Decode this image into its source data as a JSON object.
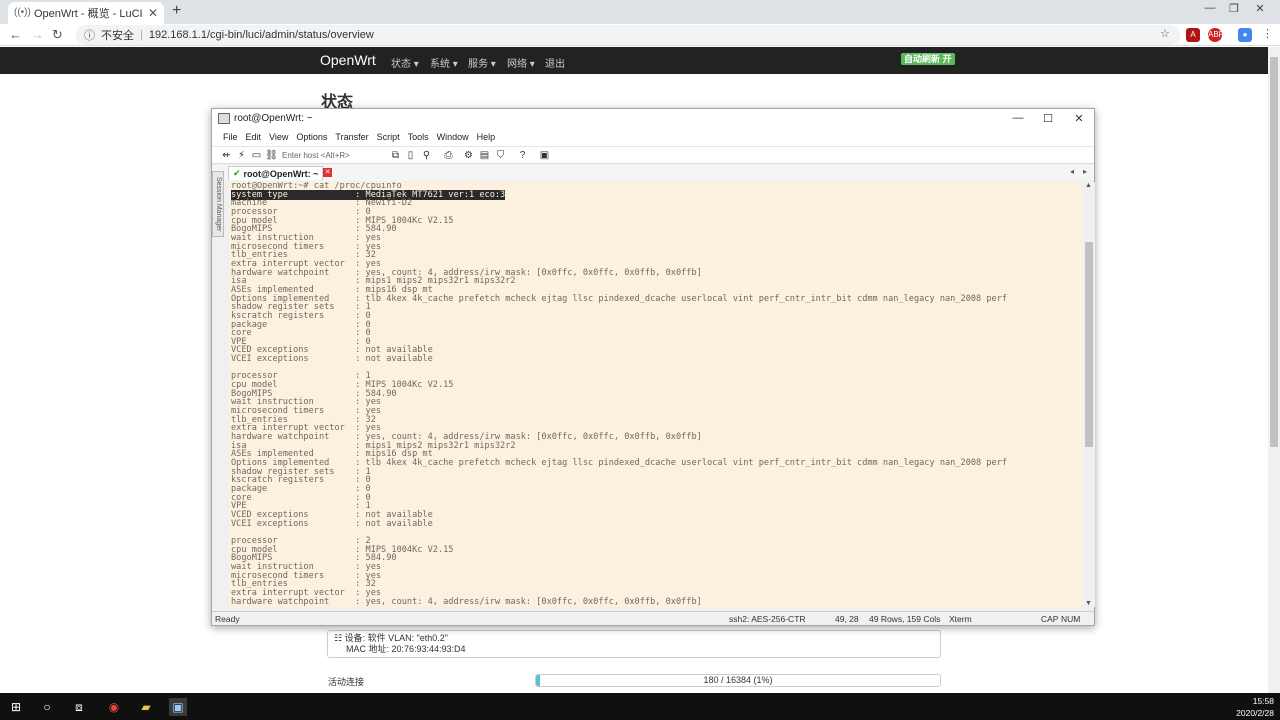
{
  "browser": {
    "tab_title": "OpenWrt - 概览 - LuCI",
    "security_label": "不安全",
    "url": "192.168.1.1/cgi-bin/luci/admin/status/overview"
  },
  "luci": {
    "brand": "OpenWrt",
    "menu": [
      "状态 ▾",
      "系统 ▾",
      "服务 ▾",
      "网络 ▾",
      "退出"
    ],
    "auto_refresh": "自动刷新 开",
    "page_title": "状态",
    "device_line1": "设备: 软件 VLAN: \"eth0.2\"",
    "device_line2": "MAC 地址: 20:76:93:44:93:D4",
    "conn_label": "活动连接",
    "conn_text": "180 / 16384 (1%)",
    "conn_fraction": 0.011
  },
  "crt": {
    "window_title": "root@OpenWrt: ~",
    "menus": [
      "File",
      "Edit",
      "View",
      "Options",
      "Transfer",
      "Script",
      "Tools",
      "Window",
      "Help"
    ],
    "host_placeholder": "Enter host <Alt+R>",
    "session_tab": "root@OpenWrt: ~",
    "session_manager": "Session Manager",
    "status": {
      "ready": "Ready",
      "cipher": "ssh2: AES-256-CTR",
      "pos": "49,  28",
      "size": "49 Rows, 159 Cols",
      "term": "Xterm",
      "cap": "CAP",
      "num": "NUM"
    },
    "lines": [
      "root@OpenWrt:~# cat /proc/cpuinfo",
      "system type             : MediaTek MT7621 ver:1 eco:3",
      "machine                 : Newifi-D2",
      "processor               : 0",
      "cpu model               : MIPS 1004Kc V2.15",
      "BogoMIPS                : 584.90",
      "wait instruction        : yes",
      "microsecond timers      : yes",
      "tlb_entries             : 32",
      "extra interrupt vector  : yes",
      "hardware watchpoint     : yes, count: 4, address/irw mask: [0x0ffc, 0x0ffc, 0x0ffb, 0x0ffb]",
      "isa                     : mips1 mips2 mips32r1 mips32r2",
      "ASEs implemented        : mips16 dsp mt",
      "Options implemented     : tlb 4kex 4k_cache prefetch mcheck ejtag llsc pindexed_dcache userlocal vint perf_cntr_intr_bit cdmm nan_legacy nan_2008 perf",
      "shadow register sets    : 1",
      "kscratch registers      : 0",
      "package                 : 0",
      "core                    : 0",
      "VPE                     : 0",
      "VCED exceptions         : not available",
      "VCEI exceptions         : not available",
      "",
      "processor               : 1",
      "cpu model               : MIPS 1004Kc V2.15",
      "BogoMIPS                : 584.90",
      "wait instruction        : yes",
      "microsecond timers      : yes",
      "tlb_entries             : 32",
      "extra interrupt vector  : yes",
      "hardware watchpoint     : yes, count: 4, address/irw mask: [0x0ffc, 0x0ffc, 0x0ffb, 0x0ffb]",
      "isa                     : mips1 mips2 mips32r1 mips32r2",
      "ASEs implemented        : mips16 dsp mt",
      "Options implemented     : tlb 4kex 4k_cache prefetch mcheck ejtag llsc pindexed_dcache userlocal vint perf_cntr_intr_bit cdmm nan_legacy nan_2008 perf",
      "shadow register sets    : 1",
      "kscratch registers      : 0",
      "package                 : 0",
      "core                    : 0",
      "VPE                     : 1",
      "VCED exceptions         : not available",
      "VCEI exceptions         : not available",
      "",
      "processor               : 2",
      "cpu model               : MIPS 1004Kc V2.15",
      "BogoMIPS                : 584.90",
      "wait instruction        : yes",
      "microsecond timers      : yes",
      "tlb_entries             : 32",
      "extra interrupt vector  : yes",
      "hardware watchpoint     : yes, count: 4, address/irw mask: [0x0ffc, 0x0ffc, 0x0ffb, 0x0ffb]"
    ]
  },
  "taskbar": {
    "time": "15:58",
    "date": "2020/2/28"
  }
}
